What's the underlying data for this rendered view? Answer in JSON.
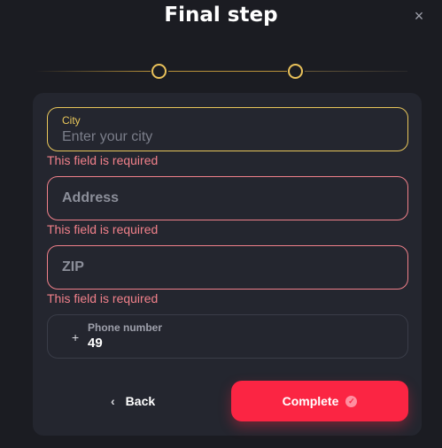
{
  "header": {
    "title": "Final step",
    "close_icon": "×"
  },
  "stepper": {
    "steps_total": 2,
    "accent_color": "#e9c15a"
  },
  "form": {
    "city": {
      "label": "City",
      "placeholder": "Enter your city",
      "value": "",
      "error": "This field is required",
      "state": "focused"
    },
    "address": {
      "placeholder": "Address",
      "value": "",
      "error": "This field is required",
      "state": "error"
    },
    "zip": {
      "placeholder": "ZIP",
      "value": "",
      "error": "This field is required",
      "state": "error"
    },
    "phone": {
      "prefix": "+",
      "label": "Phone number",
      "value": "49"
    }
  },
  "actions": {
    "back_label": "Back",
    "back_icon": "‹",
    "complete_label": "Complete",
    "complete_icon": "✓"
  },
  "colors": {
    "error": "#f0808a",
    "primary_button": "#fb2543",
    "focus_border": "#e8c65a"
  }
}
